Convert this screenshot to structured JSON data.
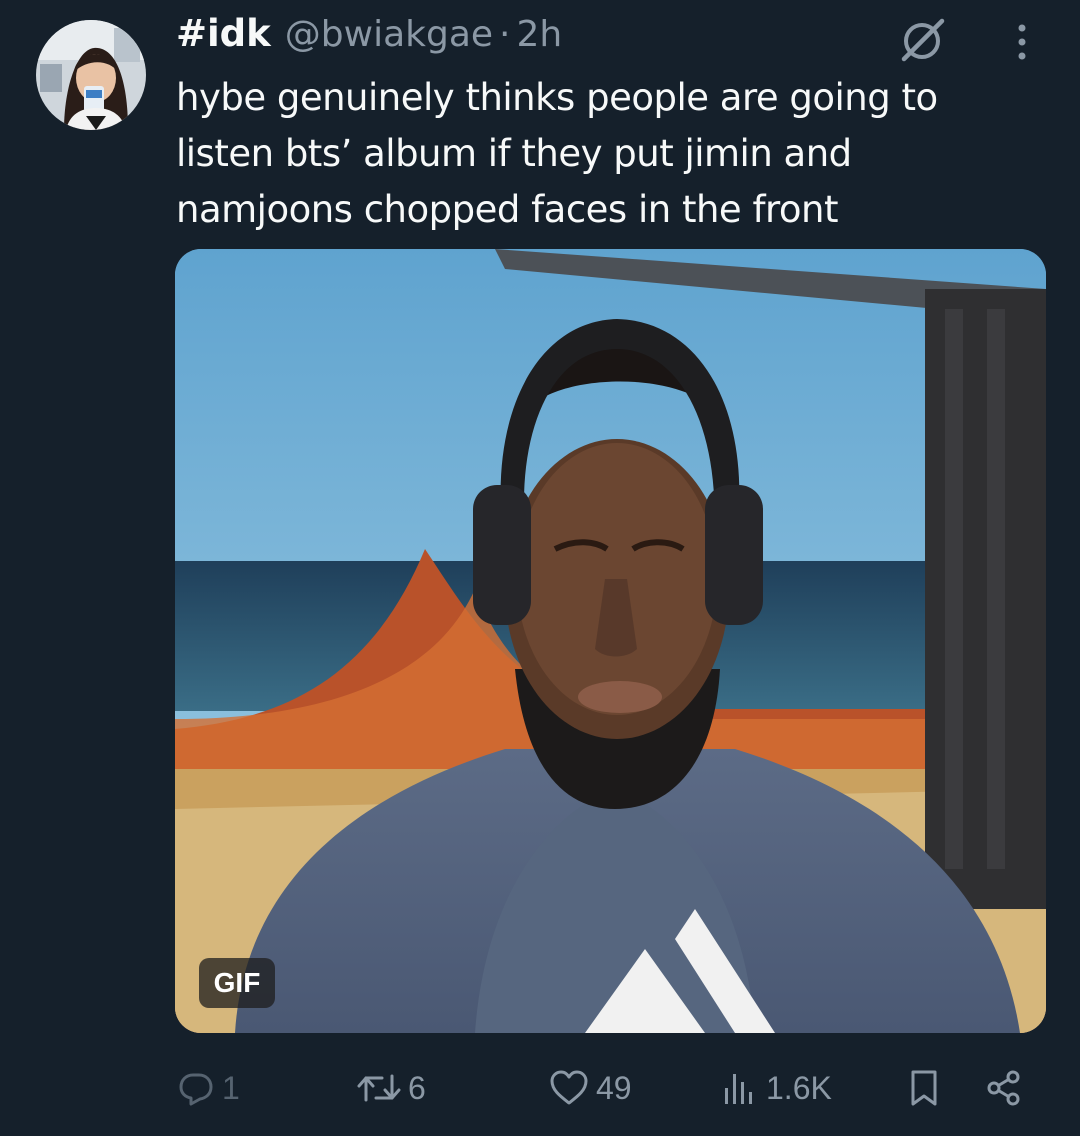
{
  "tweet": {
    "display_name": "#idk",
    "handle": "@bwiakgae",
    "separator": "·",
    "time": "2h",
    "text": "hybe genuinely thinks people are going to listen bts’ album if they put jimin and namjoons chopped faces in the front"
  },
  "media": {
    "badge": "GIF"
  },
  "actions": {
    "replies": "1",
    "retweets": "6",
    "likes": "49",
    "views": "1.6K"
  },
  "icons": {
    "grok": "grok-icon",
    "more": "more-vertical-icon",
    "reply": "reply-icon",
    "retweet": "retweet-icon",
    "like": "heart-icon",
    "views": "analytics-icon",
    "bookmark": "bookmark-icon",
    "share": "share-icon"
  },
  "colors": {
    "background": "#15202b",
    "text": "#f7f9f9",
    "muted": "#8b98a5"
  }
}
